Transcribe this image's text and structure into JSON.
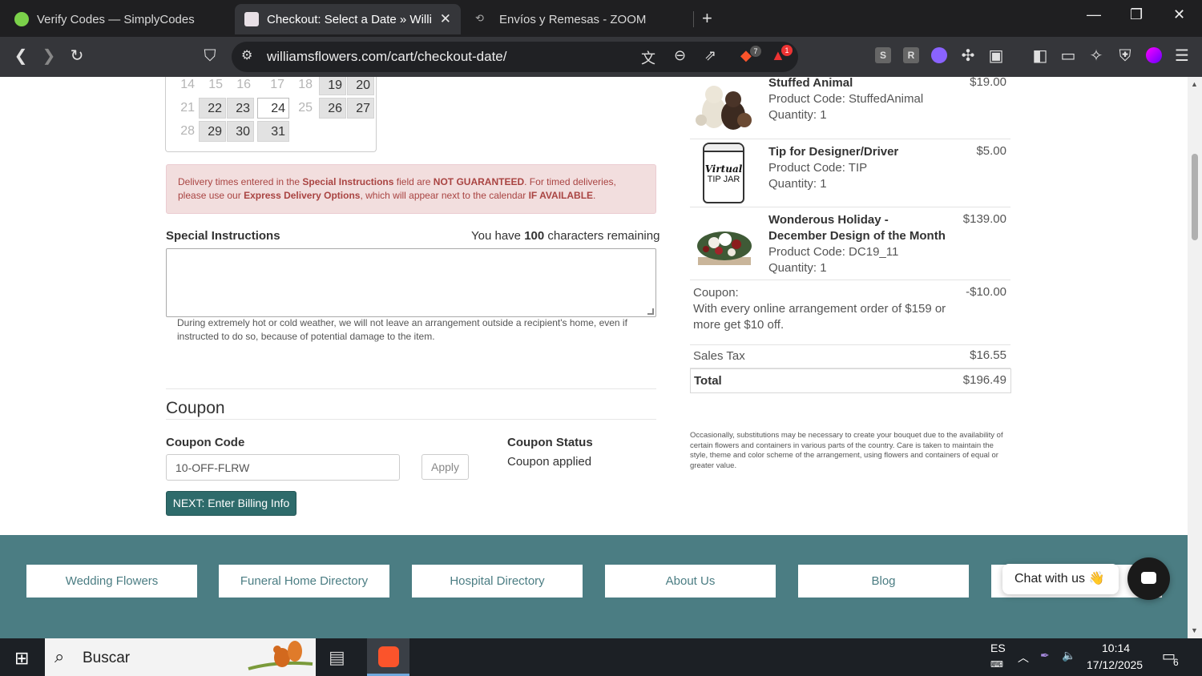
{
  "browser": {
    "tabs": [
      {
        "title": "Verify Codes — SimplyCodes"
      },
      {
        "title": "Checkout: Select a Date » William"
      },
      {
        "title": "Envíos y Remesas - ZOOM"
      }
    ],
    "url": "williamsflowers.com/cart/checkout-date/",
    "badges": {
      "brave": "7",
      "rewards": "1"
    },
    "extensions": [
      "S",
      "R"
    ]
  },
  "calendar": {
    "rows": [
      [
        "14",
        "15",
        "16",
        "17",
        "18",
        "19",
        "20"
      ],
      [
        "21",
        "22",
        "23",
        "24",
        "25",
        "26",
        "27"
      ],
      [
        "28",
        "29",
        "30",
        "31"
      ]
    ],
    "selected": "24"
  },
  "alert": {
    "p1": "Delivery times entered in the ",
    "b1": "Special Instructions",
    "p2": " field are ",
    "b2": "NOT GUARANTEED",
    "p3": ". For timed deliveries, please use our ",
    "b3": "Express Delivery Options",
    "p4": ", which will appear next to the calendar ",
    "b4": "IF AVAILABLE",
    "p5": "."
  },
  "special": {
    "label": "Special Instructions",
    "remaining_prefix": "You have ",
    "remaining_count": "100",
    "remaining_suffix": " characters remaining",
    "help": "During extremely hot or cold weather, we will not leave an arrangement outside a recipient's home, even if instructed to do so, because of potential damage to the item."
  },
  "coupon": {
    "heading": "Coupon",
    "code_label": "Coupon Code",
    "code_value": "10-OFF-FLRW",
    "apply": "Apply",
    "status_label": "Coupon Status",
    "status_value": "Coupon applied",
    "next": "NEXT: Enter Billing Info"
  },
  "cart": {
    "items": [
      {
        "name": "Stuffed Animal",
        "code": "Product Code: StuffedAnimal",
        "qty": "Quantity: 1",
        "price": "$19.00"
      },
      {
        "name": "Tip for Designer/Driver",
        "code": "Product Code: TIP",
        "qty": "Quantity: 1",
        "price": "$5.00",
        "img_text": [
          "Virtual",
          "TIP JAR"
        ]
      },
      {
        "name": "Wonderous Holiday - December Design of the Month",
        "code": "Product Code: DC19_11",
        "qty": "Quantity: 1",
        "price": "$139.00"
      }
    ],
    "coupon_label": "Coupon:",
    "coupon_desc": "With every online arrangement order of $159 or more get $10 off.",
    "coupon_amount": "-$10.00",
    "tax_label": "Sales Tax",
    "tax_value": "$16.55",
    "total_label": "Total",
    "total_value": "$196.49",
    "disclaimer": "Occasionally, substitutions may be necessary to create your bouquet due to the availability of certain flowers and containers in various parts of the country. Care is taken to maintain the style, theme and color scheme of the arrangement, using flowers and containers of equal or greater value."
  },
  "footer": {
    "links": [
      "Wedding Flowers",
      "Funeral Home Directory",
      "Hospital Directory",
      "About Us",
      "Blog"
    ]
  },
  "chat": {
    "label": "Chat with us",
    "emoji": "👋"
  },
  "taskbar": {
    "search_placeholder": "Buscar",
    "lang": "ES",
    "time": "10:14",
    "date": "17/12/2025",
    "notifications": "6"
  }
}
